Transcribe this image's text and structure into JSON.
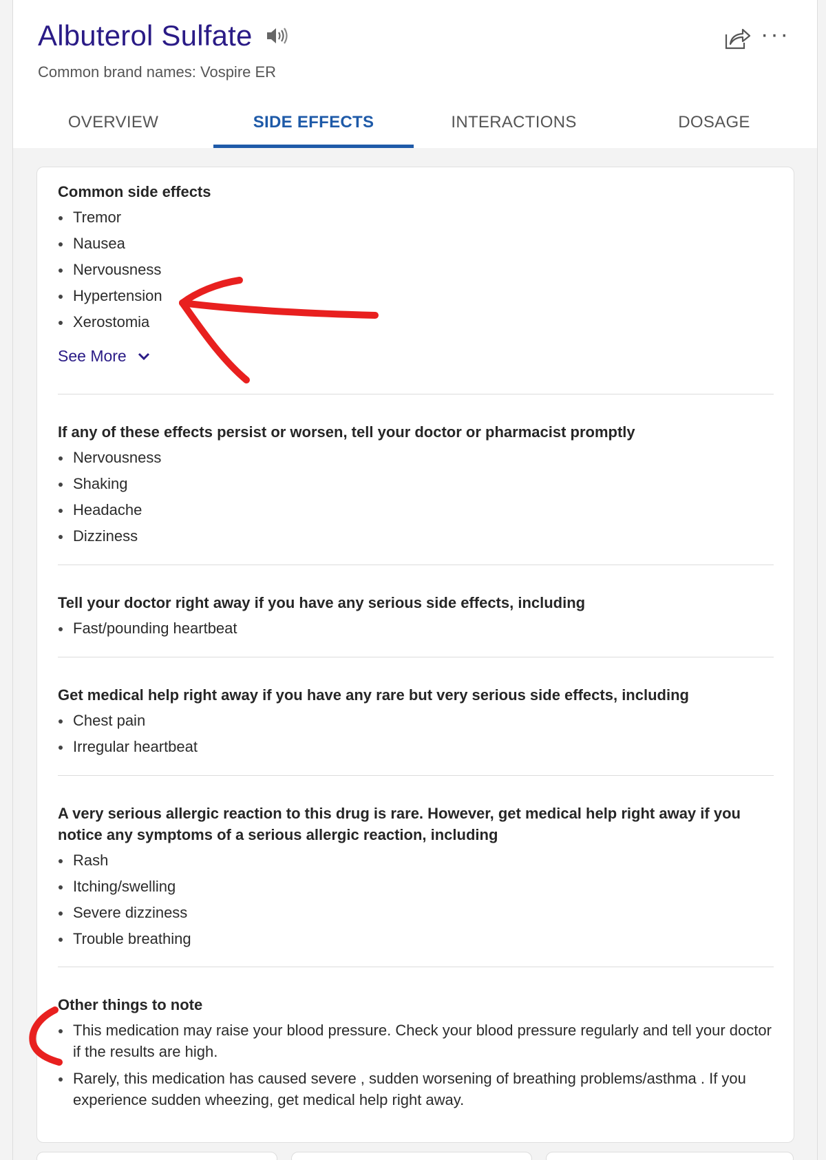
{
  "header": {
    "title": "Albuterol Sulfate",
    "brand_names": "Common brand names: Vospire ER",
    "speaker_icon": "speaker-icon",
    "share_icon": "share-icon",
    "more_label": "···"
  },
  "tabs": [
    {
      "label": "OVERVIEW",
      "active": false
    },
    {
      "label": "SIDE EFFECTS",
      "active": true
    },
    {
      "label": "INTERACTIONS",
      "active": false
    },
    {
      "label": "DOSAGE",
      "active": false
    }
  ],
  "colors": {
    "title": "#2a1b86",
    "active_tab": "#1e5aa8",
    "annotation": "#e8201f"
  },
  "sections": {
    "common": {
      "heading": "Common side effects",
      "items": [
        "Tremor",
        "Nausea",
        "Nervousness",
        "Hypertension",
        "Xerostomia"
      ],
      "see_more": "See More"
    },
    "persist": {
      "heading": "If any of these effects persist or worsen, tell your doctor or pharmacist promptly",
      "items": [
        "Nervousness",
        "Shaking",
        "Headache",
        "Dizziness"
      ]
    },
    "serious": {
      "heading": "Tell your doctor right away if you have any serious side effects, including",
      "items": [
        "Fast/pounding heartbeat"
      ]
    },
    "rare": {
      "heading": "Get medical help right away if you have any rare but very serious side effects, including",
      "items": [
        "Chest pain",
        "Irregular heartbeat"
      ]
    },
    "allergic": {
      "heading": "A very serious allergic reaction to this drug is rare. However, get medical help right away if you notice any symptoms of a serious allergic reaction, including",
      "items": [
        "Rash",
        "Itching/swelling",
        "Severe dizziness",
        "Trouble breathing"
      ]
    },
    "other": {
      "heading": "Other things to note",
      "items": [
        "This medication may raise your blood pressure. Check your blood pressure regularly and tell your doctor if the results are high.",
        "Rarely, this medication has caused severe , sudden worsening of breathing problems/asthma . If you experience sudden wheezing, get medical help right away."
      ]
    }
  }
}
